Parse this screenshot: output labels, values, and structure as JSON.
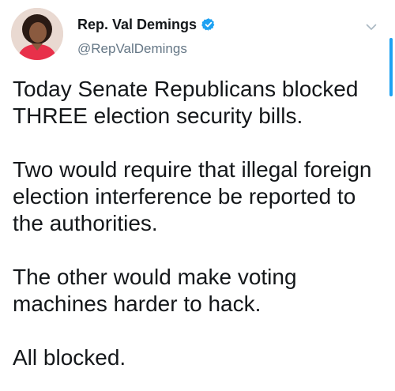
{
  "author": {
    "name": "Rep. Val Demings",
    "handle": "@RepValDemings",
    "verified": true
  },
  "icons": {
    "verified": "verified-badge-icon",
    "more": "chevron-down-icon"
  },
  "colors": {
    "accent": "#1da1f2",
    "handle": "#657786",
    "text": "#14171a"
  },
  "tweet": {
    "paragraphs": [
      "Today Senate Republicans blocked THREE election security bills.",
      "Two would require that illegal foreign election interference be reported to the authorities.",
      "The other would make voting machines harder to hack.",
      "All blocked."
    ]
  }
}
